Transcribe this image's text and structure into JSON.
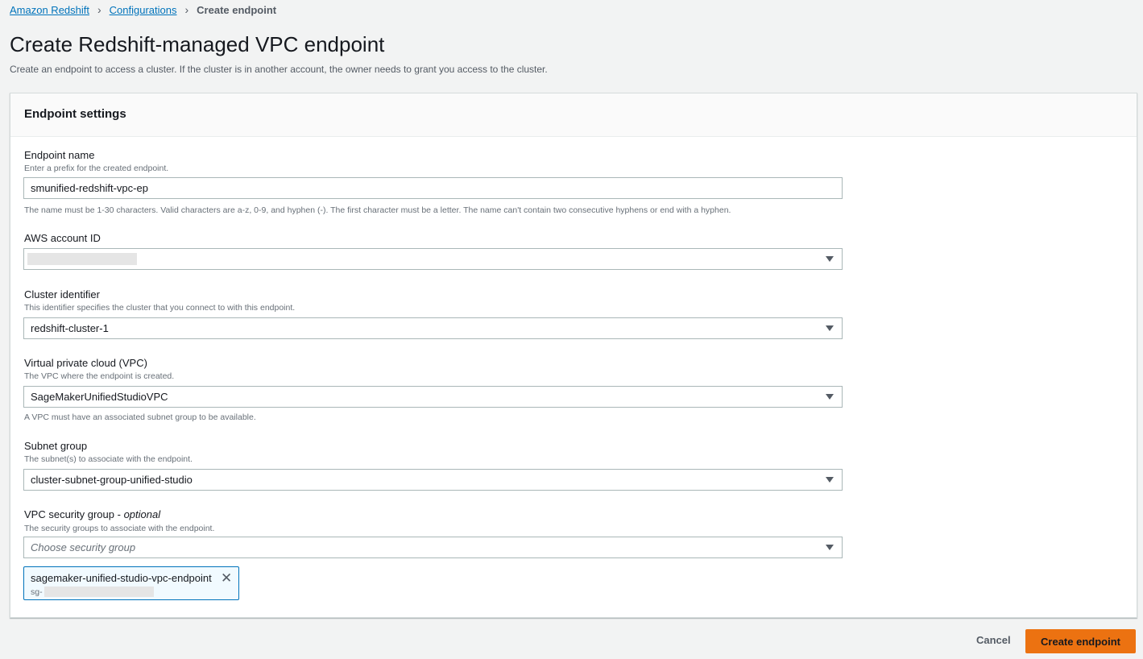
{
  "breadcrumb": {
    "item1": "Amazon Redshift",
    "item2": "Configurations",
    "current": "Create endpoint"
  },
  "page": {
    "title": "Create Redshift-managed VPC endpoint",
    "description": "Create an endpoint to access a cluster. If the cluster is in another account, the owner needs to grant you access to the cluster."
  },
  "panel": {
    "title": "Endpoint settings"
  },
  "endpoint_name": {
    "label": "Endpoint name",
    "hint": "Enter a prefix for the created endpoint.",
    "value": "smunified-redshift-vpc-ep",
    "constraint": "The name must be 1-30 characters. Valid characters are a-z, 0-9, and hyphen (-). The first character must be a letter. The name can't contain two consecutive hyphens or end with a hyphen."
  },
  "account_id": {
    "label": "AWS account ID"
  },
  "cluster": {
    "label": "Cluster identifier",
    "hint": "This identifier specifies the cluster that you connect to with this endpoint.",
    "value": "redshift-cluster-1"
  },
  "vpc": {
    "label": "Virtual private cloud (VPC)",
    "hint": "The VPC where the endpoint is created.",
    "value": "SageMakerUnifiedStudioVPC",
    "note": "A VPC must have an associated subnet group to be available."
  },
  "subnet": {
    "label": "Subnet group",
    "hint": "The subnet(s) to associate with the endpoint.",
    "value": "cluster-subnet-group-unified-studio"
  },
  "security_group": {
    "label": "VPC security group -",
    "optional": "optional",
    "hint": "The security groups to associate with the endpoint.",
    "placeholder": "Choose security group",
    "token_name": "sagemaker-unified-studio-vpc-endpoint",
    "token_id_prefix": "sg-"
  },
  "footer": {
    "cancel": "Cancel",
    "create": "Create endpoint"
  },
  "colors": {
    "accent": "#ec7211",
    "link": "#0073bb"
  }
}
